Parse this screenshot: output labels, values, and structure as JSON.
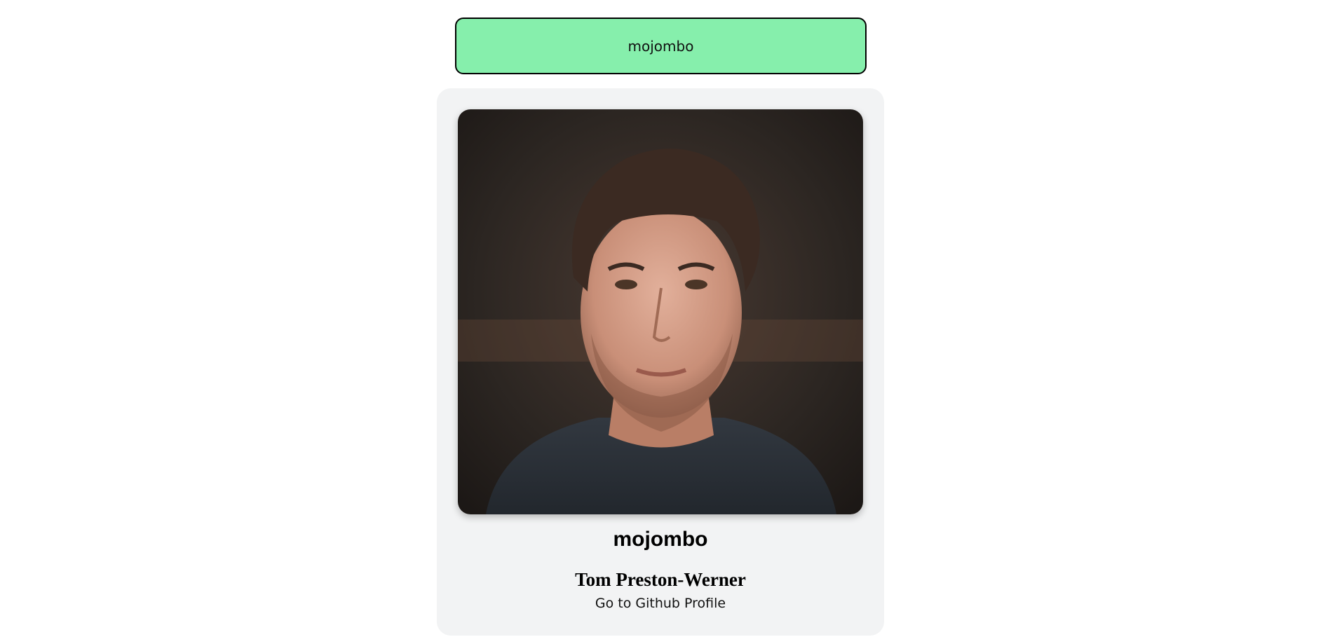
{
  "search": {
    "value": "mojombo",
    "accent_color": "#86efac"
  },
  "profile": {
    "login": "mojombo",
    "name": "Tom Preston-Werner",
    "link_label": "Go to Github Profile"
  }
}
